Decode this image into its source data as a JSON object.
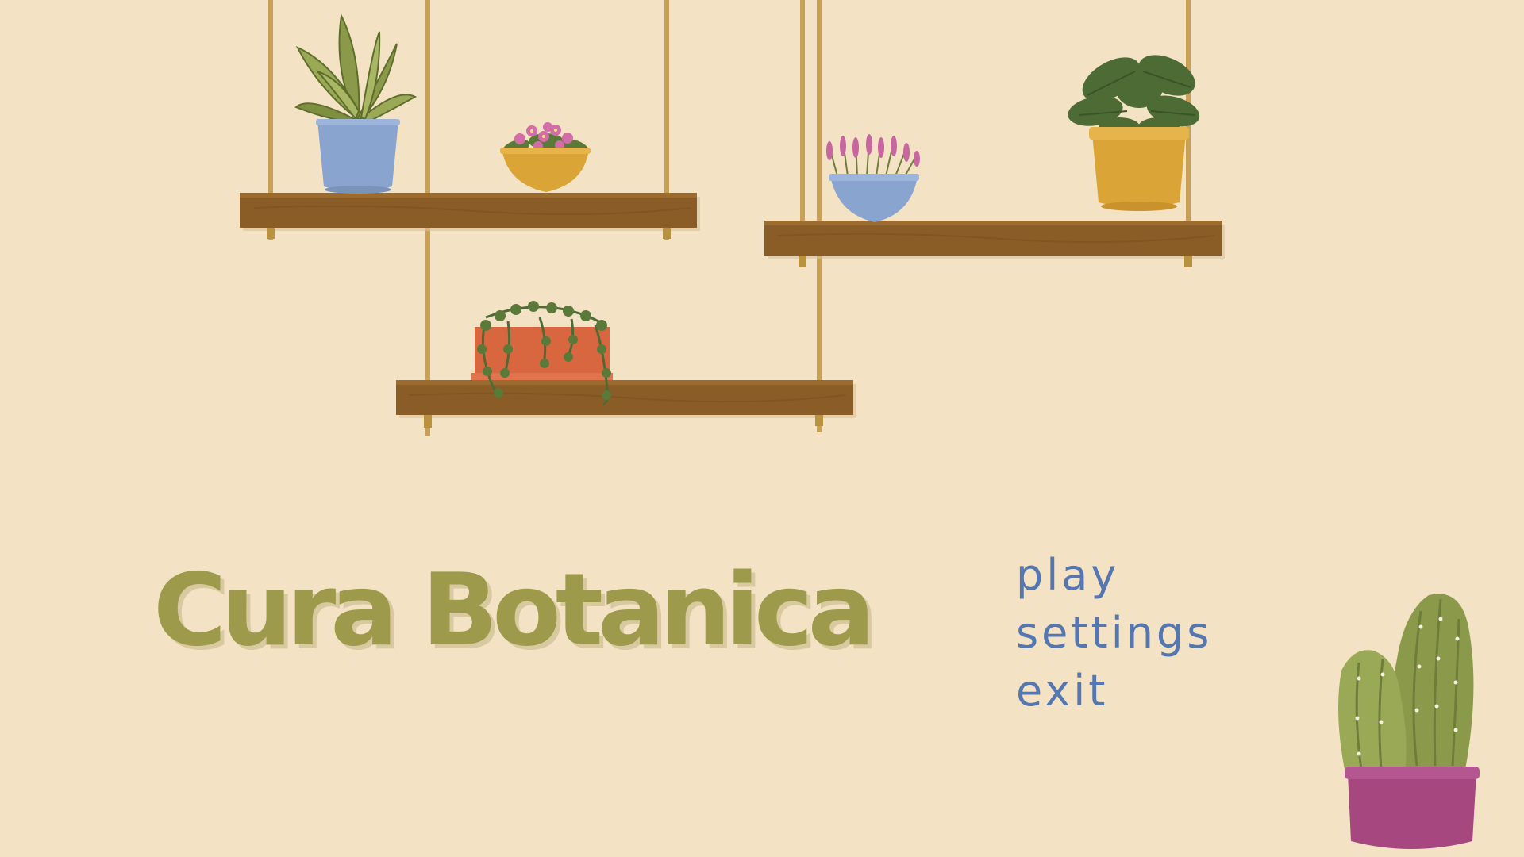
{
  "game": {
    "title": "Cura Botanica",
    "menu": [
      {
        "id": "play",
        "label": "play"
      },
      {
        "id": "settings",
        "label": "settings"
      },
      {
        "id": "exit",
        "label": "exit"
      }
    ]
  },
  "colors": {
    "background": "#f4e2c5",
    "title": "#9d9a4b",
    "title_shadow": "#d8c9a0",
    "menu_text": "#5577b1",
    "shelf_wood": "#8a5c26",
    "rope": "#c9a156",
    "pot_blue": "#89a5cf",
    "pot_yellow": "#dba437",
    "pot_terracotta": "#d8663f",
    "pot_magenta": "#a6487f",
    "leaf_dark": "#4d6b35",
    "leaf_light": "#8a9a4a",
    "flower_pink": "#d36da7"
  },
  "decor": {
    "shelves": [
      "upper-left-shelf",
      "lower-middle-shelf",
      "right-shelf"
    ],
    "plants": [
      "dracaena-in-blue-pot",
      "african-violet-in-yellow-bowl",
      "string-of-pearls-in-terracotta-planter",
      "lavender-in-blue-bowl",
      "calathea-in-yellow-pot",
      "cactus-in-magenta-pot"
    ]
  }
}
